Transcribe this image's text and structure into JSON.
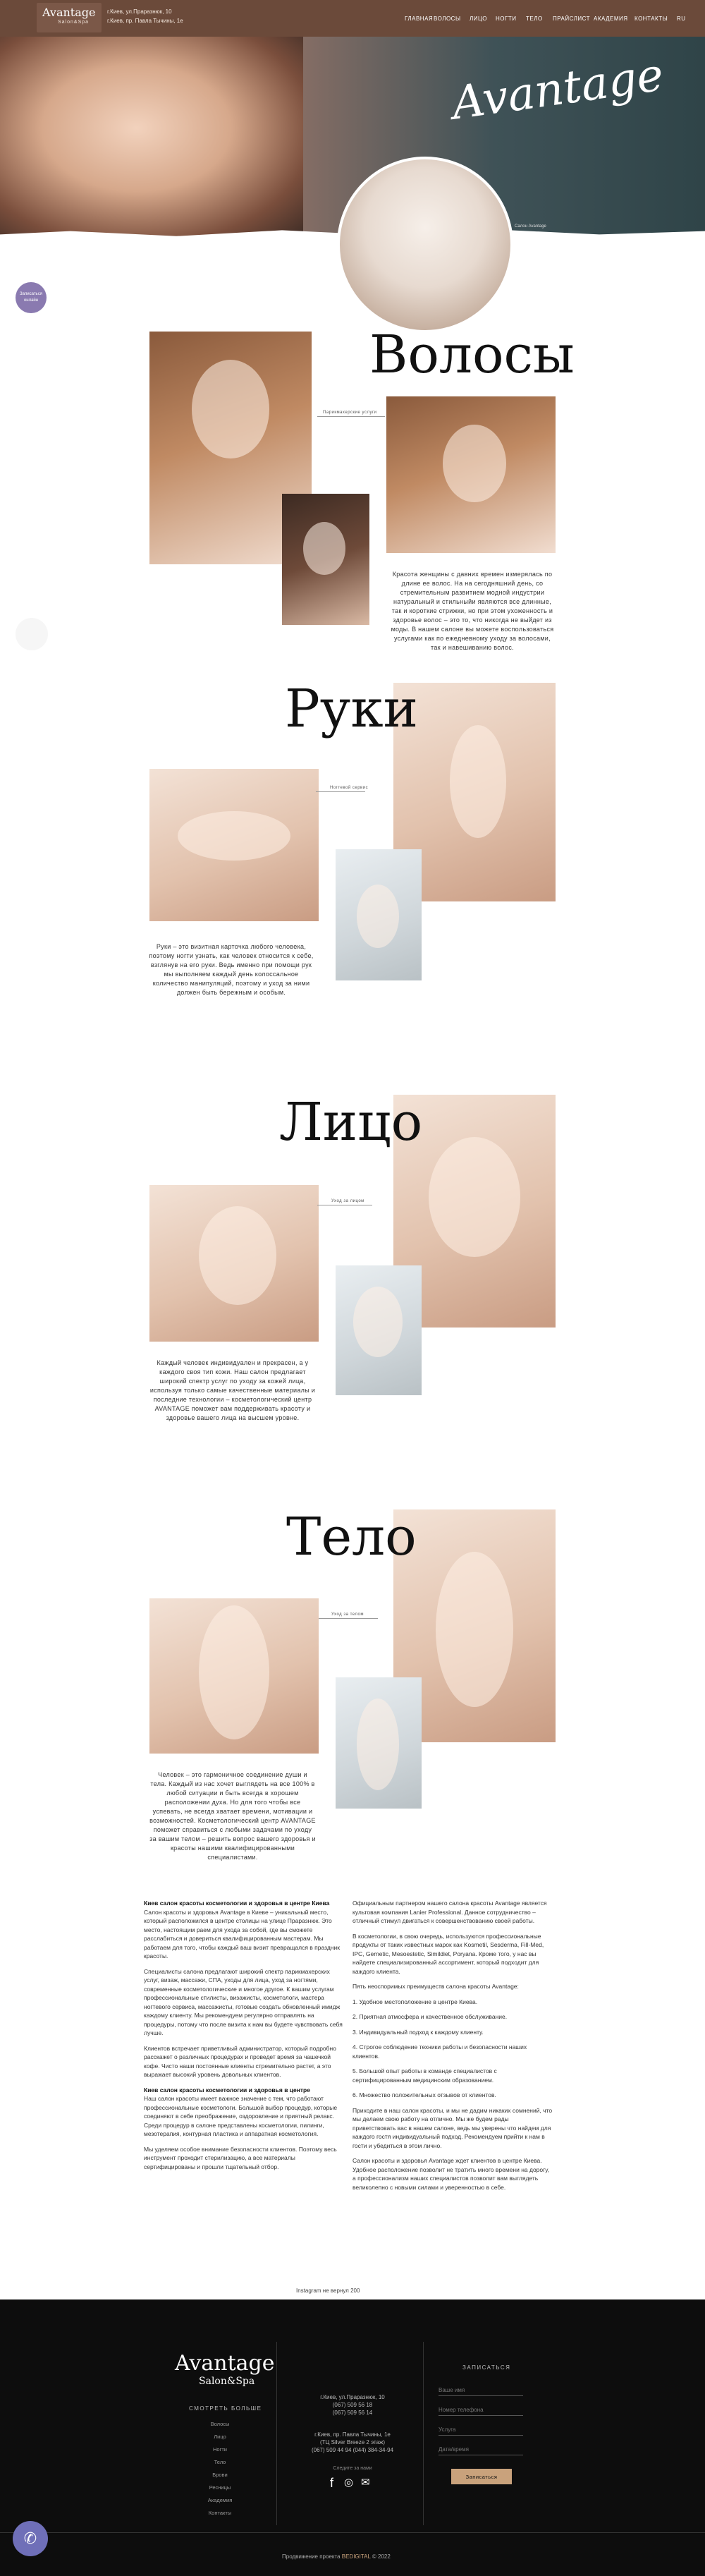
{
  "header": {
    "logo_title": "Avantage",
    "logo_subtitle": "Salon&Spa",
    "address_1": "г.Киев, ул.Праразнюк, 10",
    "address_2": "г.Киев, пр. Павла Тычины, 1е",
    "nav": [
      "Главная",
      "Волосы",
      "Лицо",
      "Ногти",
      "Тело",
      "Прайслист",
      "Академия",
      "Контакты",
      "RU"
    ]
  },
  "hero": {
    "brand": "Avantage",
    "caption": "Салон Avantage"
  },
  "side_badge": "Записаться онлайн",
  "sections": [
    {
      "title": "Волосы",
      "tag": "Парикмахерские услуги",
      "text": "Красота женщины с давних времен измерялась по длине ее волос. На на сегодняшний день, со стремительным развитием модной индустрии натуральный и стильныйи являются все длинные, так и короткие стрижки, но при этом ухоженность и здоровье волос – это то, что никогда не выйдет из моды. В нашем салоне вы можете воспользоваться услугами как по ежедневному уходу за волосами, так и навешиванию волос."
    },
    {
      "title": "Руки",
      "tag": "Ногтевой сервис",
      "text": "Руки – это визитная карточка любого человека, поэтому ногти узнать, как человек относится к себе, взглянув на его руки. Ведь именно при помощи рук мы выполняем каждый день колоссальное количество манипуляций, поэтому и уход за ними должен быть бережным и особым."
    },
    {
      "title": "Лицо",
      "tag": "Уход за лицом",
      "text": "Каждый человек индивидуален и прекрасен, а у каждого своя тип кожи. Наш салон предлагает широкий спектр услуг по уходу за кожей лица, используя только самые качественные материалы и последние технологии – косметологический центр AVANTAGE поможет вам поддерживать красоту и здоровье вашего лица на высшем уровне."
    },
    {
      "title": "Тело",
      "tag": "Уход за телом",
      "text": "Человек – это гармоничное соединение души и тела. Каждый из нас хочет выглядеть на все 100% в любой ситуации и быть всегда в хорошем расположении духа. Но для того чтобы все успевать, не всегда хватает времени, мотивации и возможностей. Косметологический центр AVANTAGE поможет справиться с любыми задачами по уходу за вашим телом – решить вопрос вашего здоровья и красоты нашими квалифицированными специалистами."
    }
  ],
  "article_left": [
    {
      "bold": "Киев салон красоты косметологии и здоровья в центре Киева",
      "text": "Салон красоты и здоровья Avantage в Киеве – уникальный место, который расположился в центре столицы на улице Праразнюк. Это место, настоящим раем для ухода за собой, где вы сможете расслабиться и довериться квалифицированным мастерам. Мы работаем для того, чтобы каждый ваш визит превращался в праздник красоты."
    },
    {
      "bold": "",
      "text": "Специалисты салона предлагают широкий спектр парикмахерских услуг, визаж, массажи, СПА, уходы для лица, уход за ногтями, современные косметологические и многое другое. К вашим услугам профессиональные стилисты, визажисты, косметологи, мастера ногтевого сервиса, массажисты, готовые создать обновленный имидж каждому клиенту. Мы рекомендуем регулярно отправлять на процедуры, потому что после визита к нам вы будете чувствовать себя лучше."
    },
    {
      "bold": "",
      "text": "Клиентов встречает приветливый администратор, который подробно расскажет о различных процедурах и проведет время за чашечкой кофе. Чисто наши постоянные клиенты стремительно растет, а это выражает высокий уровень довольных клиентов."
    },
    {
      "bold": "Киев салон красоты косметологии и здоровья в центре",
      "text": "Наш салон красоты имеет важное значение с тем, что работают профессиональные косметологи. Большой выбор процедур, которые соединяют в себе преображение, оздоровление и приятный релакс. Среди процедур в салоне представлены косметологии, пилинги, мезотерапия, контурная пластика и аппаратная косметология."
    },
    {
      "bold": "",
      "text": "Мы уделяем особое внимание безопасности клиентов. Поэтому весь инструмент проходит стерилизацию, а все материалы сертифицированы и прошли тщательный отбор."
    }
  ],
  "article_right": [
    "Официальным партнером нашего салона красоты Avantage является культовая компания Lanier Professional. Данное сотрудничество – отличный стимул двигаться к совершенствованию своей работы.",
    "В косметологии, в свою очередь, используются профессиональные продукты от таких известных марок как Kosmetil, Sesderma, Fill-Med, IPC, Gernetic, Mesoestetic, Simildiet, Poryana. Кроме того, у нас вы найдете специализированный ассортимент, который подходит для каждого клиента.",
    "Пять неоспоримых преимуществ салона красоты Avantage:",
    "1. Удобное местоположение в центре Киева.",
    "2. Приятная атмосфера и качественное обслуживание.",
    "3. Индивидуальный подход к каждому клиенту.",
    "4. Строгое соблюдение техники работы и безопасности наших клиентов.",
    "5. Большой опыт работы в команде специалистов с сертифицированным медицинским образованием.",
    "6. Множество положительных отзывов от клиентов.",
    "Приходите в наш салон красоты, и мы не дадим никаких сомнений, что мы делаем свою работу на отлично. Мы же будем рады приветствовать вас в нашем салоне, ведь мы уверены что найдем для каждого гостя индивидуальный подход. Рекомендуем прийти к нам в гости и убедиться в этом лично.",
    "Салон красоты и здоровья Avantage ждет клиентов в центре Киева. Удобное расположение позволит не тратить много времени на дорогу, а профессионализм наших специалистов позволит вам выглядеть великолепно с новыми силами и уверенностью в себе."
  ],
  "instagram_label": "Instagram не вернул 200",
  "footer": {
    "brand": "Avantage",
    "brand_sub": "Salon&Spa",
    "services_heading": "Смотреть больше",
    "services": [
      "Волосы",
      "Лицо",
      "Ногти",
      "Тело",
      "Брови",
      "Ресницы",
      "Академия",
      "Контакты"
    ],
    "addr_1": "г.Киев, ул.Праразнюк, 10",
    "phone_1": "(067) 509 56 18",
    "phone_2": "(067) 509 56 14",
    "addr_2": "г.Киев, пр. Павла Тычины, 1е",
    "addr_2b": "(ТЦ Silver Breeze 2 этаж)",
    "phone_3": "(067) 509 44 94 (044) 384-34-94",
    "social_heading": "Следите за нами",
    "form_heading": "Записаться",
    "fields": [
      "Ваше имя",
      "Номер телефона",
      "Услуга",
      "Дата/время"
    ],
    "submit": "Записаться",
    "copy_prefix": "Продвижение проекта",
    "copy_link": "BEDIGITAL",
    "copy_year": "© 2022"
  },
  "colors": {
    "header": "#6b4a3a",
    "footer": "#0d0d0d",
    "accent": "#c9a27c",
    "badge": "#8a7ab0"
  },
  "icons": [
    "phone-icon",
    "facebook-icon",
    "instagram-icon",
    "mail-icon"
  ]
}
